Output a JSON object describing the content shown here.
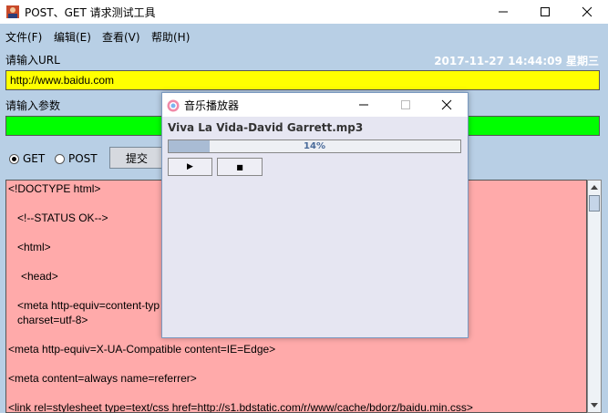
{
  "window": {
    "title": "POST、GET 请求测试工具",
    "minimize": "─",
    "maximize": "☐",
    "close": "✕"
  },
  "menu": {
    "items": [
      "文件(F)",
      "编辑(E)",
      "查看(V)",
      "帮助(H)"
    ]
  },
  "url": {
    "label": "请输入URL",
    "value": "http://www.baidu.com"
  },
  "datetime": "2017-11-27 14:44:09 星期三",
  "params": {
    "label": "请输入参数",
    "value": ""
  },
  "method": {
    "get_label": "GET",
    "post_label": "POST",
    "selected": "GET"
  },
  "submit_label": "提交",
  "response": {
    "lines": [
      "<!DOCTYPE html>",
      "",
      "<!--STATUS OK-->",
      "",
      "<html>",
      "",
      "<head>",
      "",
      "<meta http-equiv=content-typ",
      "charset=utf-8>",
      "",
      "<meta http-equiv=X-UA-Compatible content=IE=Edge>",
      "",
      "<meta content=always name=referrer>",
      "",
      "<link rel=stylesheet type=text/css href=http://s1.bdstatic.com/r/www/cache/bdorz/baidu.min.css>"
    ]
  },
  "player": {
    "title": "音乐播放器",
    "song": "Viva La Vida-David Garrett.mp3",
    "progress_percent": 14,
    "progress_text": "14%",
    "play_symbol": "▶",
    "stop_symbol": "■"
  },
  "colors": {
    "url_bg": "#ffff00",
    "param_bg": "#00ff00",
    "response_bg": "#ffaaaa",
    "window_bg": "#b8cfe5"
  }
}
